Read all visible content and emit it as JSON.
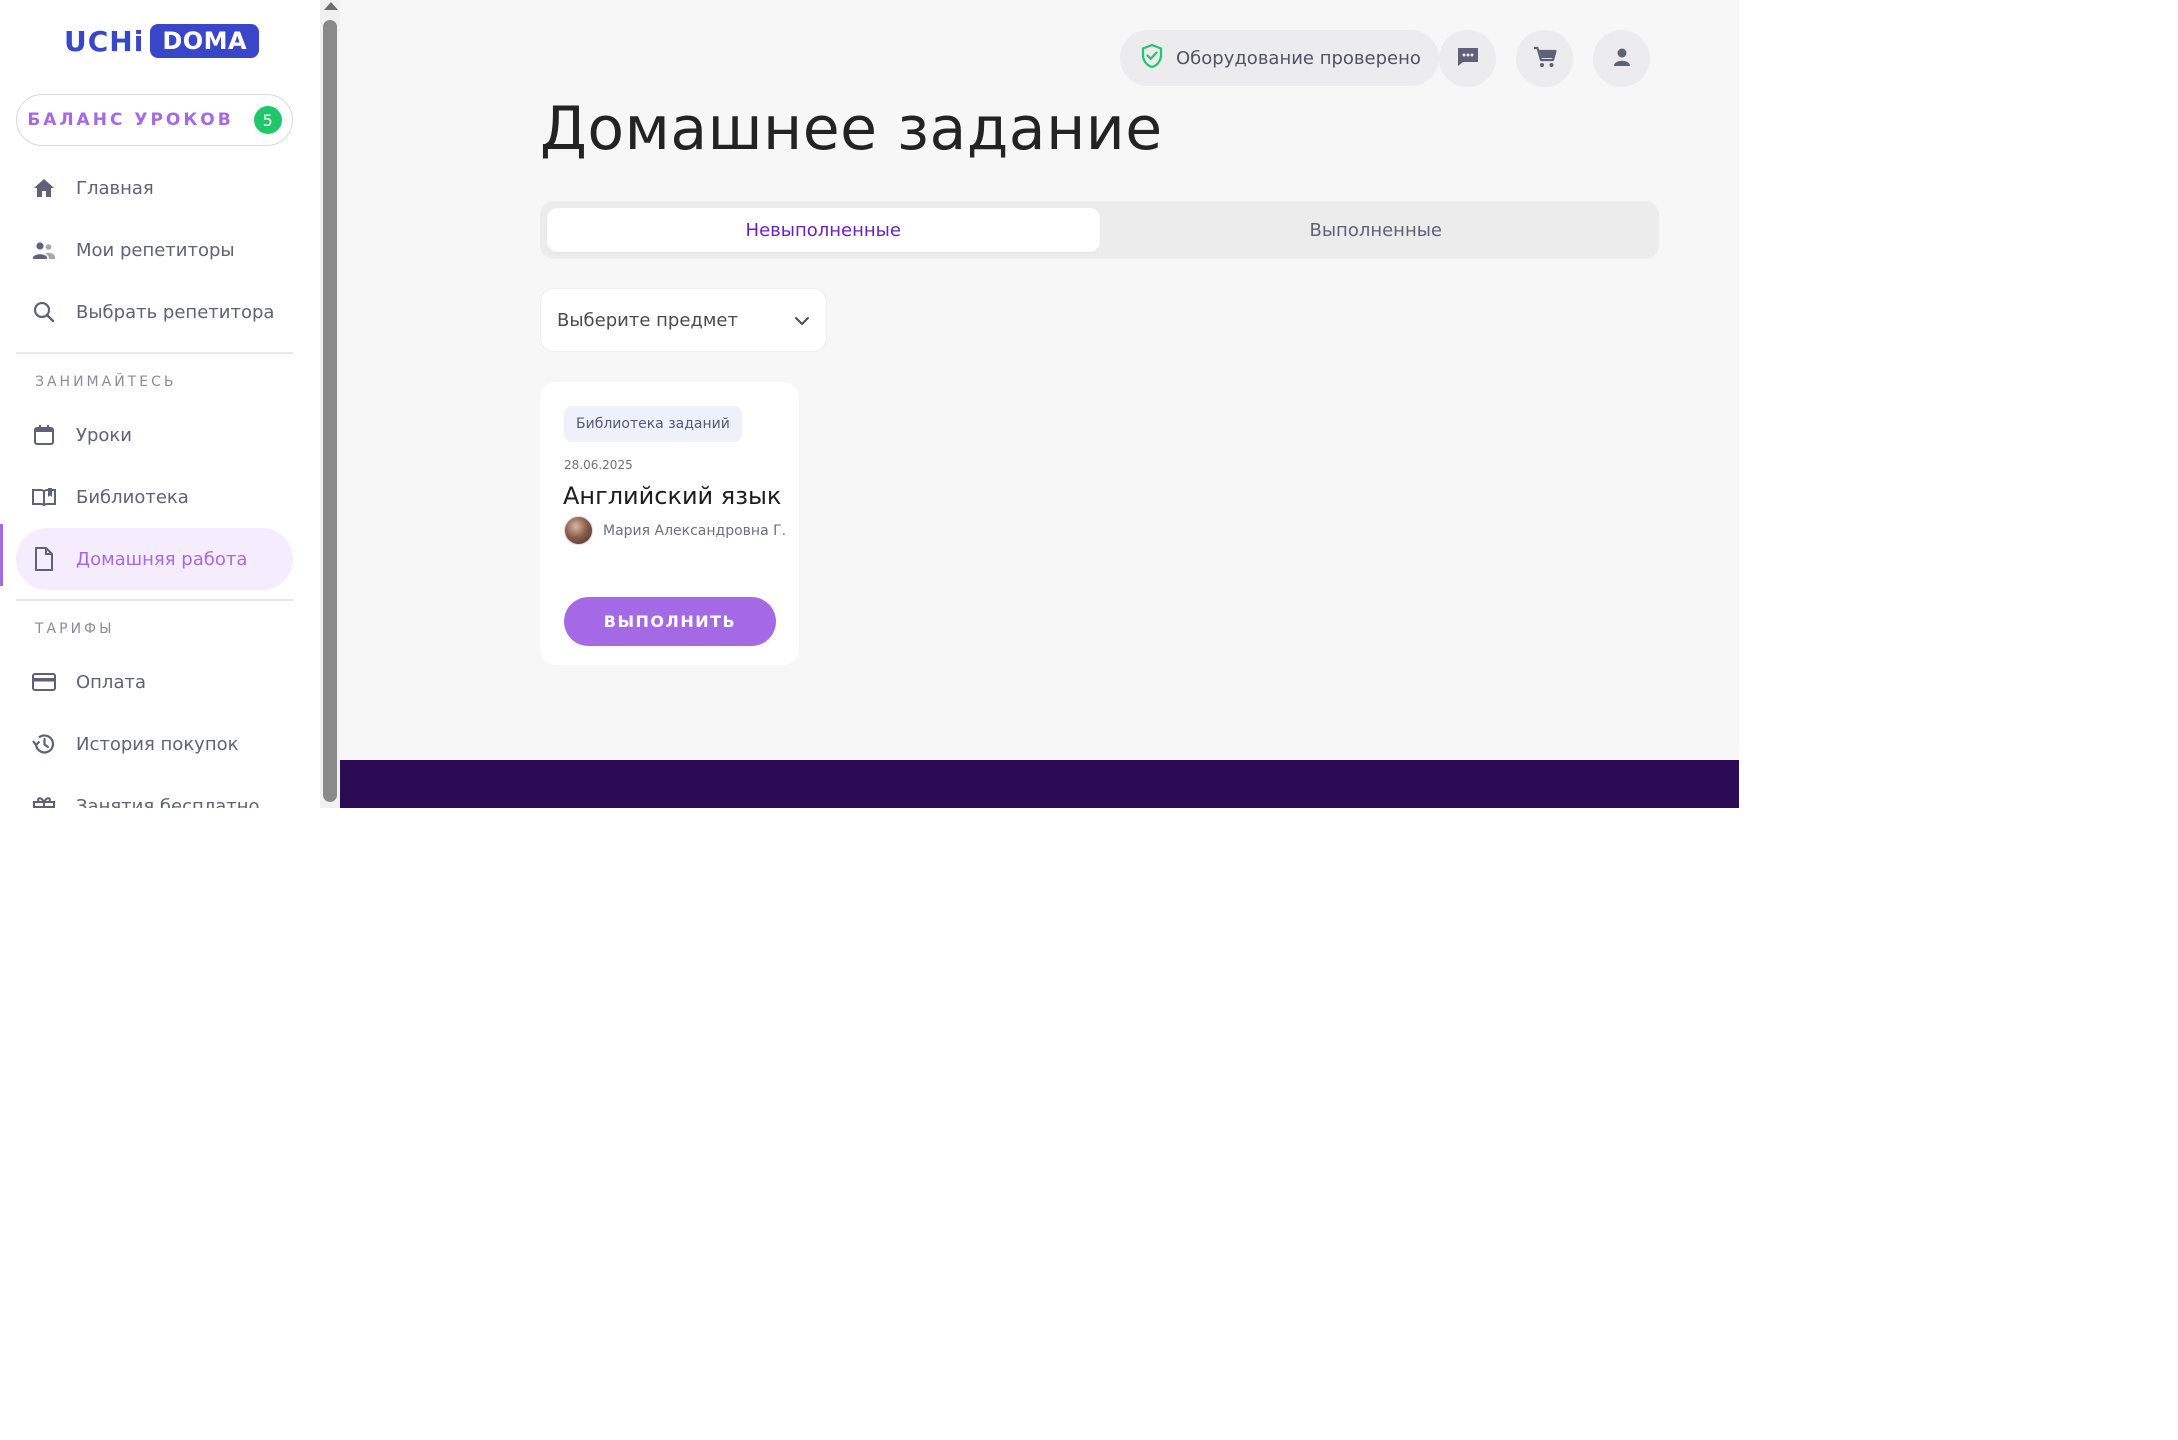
{
  "logo": {
    "part1": "UCHi",
    "part2": "DOMA"
  },
  "balance": {
    "label": "БАЛАНС УРОКОВ",
    "count": "5"
  },
  "sidebar": {
    "items_top": [
      {
        "label": "Главная",
        "icon": "home-icon"
      },
      {
        "label": "Мои репетиторы",
        "icon": "people-icon"
      },
      {
        "label": "Выбрать репетитора",
        "icon": "search-icon"
      }
    ],
    "section1": "ЗАНИМАЙТЕСЬ",
    "items_study": [
      {
        "label": "Уроки",
        "icon": "calendar-icon"
      },
      {
        "label": "Библиотека",
        "icon": "book-icon"
      },
      {
        "label": "Домашняя работа",
        "icon": "document-icon",
        "active": true
      }
    ],
    "section2": "ТАРИФЫ",
    "items_tariffs": [
      {
        "label": "Оплата",
        "icon": "card-icon"
      },
      {
        "label": "История покупок",
        "icon": "history-icon"
      },
      {
        "label": "Занятия бесплатно",
        "icon": "gift-icon"
      }
    ]
  },
  "header": {
    "equipment_status": "Оборудование проверено",
    "icons": [
      "chat-icon",
      "cart-icon",
      "profile-icon"
    ]
  },
  "page": {
    "title": "Домашнее задание",
    "tabs": [
      {
        "label": "Невыполненные",
        "active": true
      },
      {
        "label": "Выполненные",
        "active": false
      }
    ],
    "subject_select": {
      "placeholder": "Выберите предмет"
    }
  },
  "card": {
    "badge": "Библиотека заданий",
    "date": "28.06.2025",
    "subject": "Английский язык",
    "tutor": "Мария Александровна Г.",
    "button": "ВЫПОЛНИТЬ"
  },
  "colors": {
    "accent": "#a46ae6",
    "brand_blue": "#3a46c9",
    "footer": "#2d0b54",
    "badge_green": "#1fc76a",
    "active_tab_text": "#6a1fc2"
  }
}
